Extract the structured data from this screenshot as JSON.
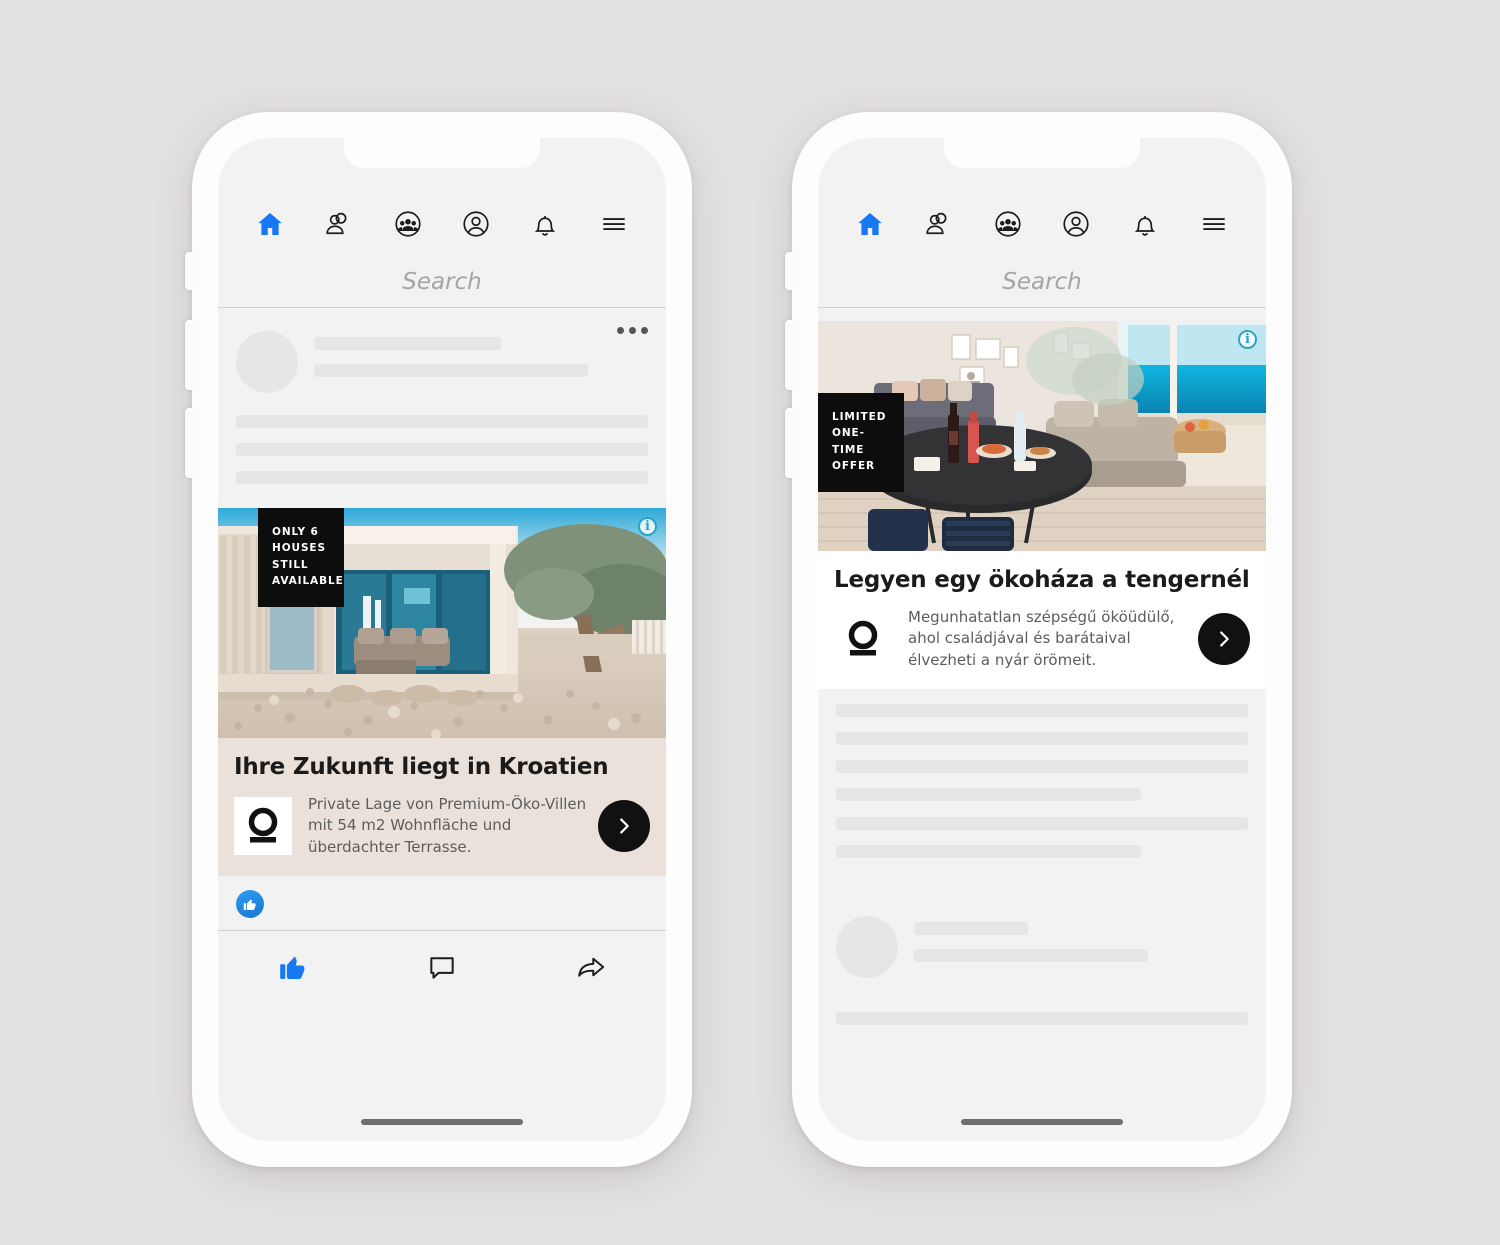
{
  "scene": {
    "background_color": "#e3e0e0",
    "accent_blue": "#1877f2",
    "info_badge_color": "#2aa4c4"
  },
  "phones": [
    {
      "id": "phone-left",
      "nav": {
        "items": [
          {
            "name": "home-icon",
            "label": "Home",
            "active": true
          },
          {
            "name": "friends-icon",
            "label": "Friends",
            "active": false
          },
          {
            "name": "groups-icon",
            "label": "Groups",
            "active": false
          },
          {
            "name": "profile-icon",
            "label": "Profile",
            "active": false
          },
          {
            "name": "bell-icon",
            "label": "Notifications",
            "active": false
          },
          {
            "name": "menu-icon",
            "label": "Menu",
            "active": false
          }
        ]
      },
      "search": {
        "placeholder": "Search",
        "value": ""
      },
      "post": {
        "more_options_label": "More options"
      },
      "ad": {
        "badge_text": "ONLY 6\nHOUSES STILL\nAVAILABLE",
        "badge_line1": "ONLY 6",
        "badge_line2": "HOUSES STILL",
        "badge_line3": "AVAILABLE",
        "info_label": "i",
        "headline": "Ihre Zukunft liegt in Kroatien",
        "description": "Private Lage von Premium-Öko-Villen mit 54 m2 Wohnfläche und überdachter Terrasse.",
        "cta_label": "›",
        "caption_background": "#e9e1da"
      },
      "reactions": {
        "like_label": "Like"
      },
      "actions": [
        {
          "name": "like-button",
          "label": "Like"
        },
        {
          "name": "comment-button",
          "label": "Comment"
        },
        {
          "name": "share-button",
          "label": "Share"
        }
      ]
    },
    {
      "id": "phone-right",
      "nav": {
        "items": [
          {
            "name": "home-icon",
            "label": "Home",
            "active": true
          },
          {
            "name": "friends-icon",
            "label": "Friends",
            "active": false
          },
          {
            "name": "groups-icon",
            "label": "Groups",
            "active": false
          },
          {
            "name": "profile-icon",
            "label": "Profile",
            "active": false
          },
          {
            "name": "bell-icon",
            "label": "Notifications",
            "active": false
          },
          {
            "name": "menu-icon",
            "label": "Menu",
            "active": false
          }
        ]
      },
      "search": {
        "placeholder": "Search",
        "value": ""
      },
      "ad": {
        "badge_line1": "LIMITED",
        "badge_line2": "ONE-TIME",
        "badge_line3": "OFFER",
        "info_label": "i",
        "headline": "Legyen egy ökoháza a tengernél",
        "description": "Megunhatatlan szépségű ököüdülő, ahol családjával és barátaival élvezheti a nyár örömeit.",
        "cta_label": "›",
        "caption_background": "#ffffff"
      }
    }
  ]
}
